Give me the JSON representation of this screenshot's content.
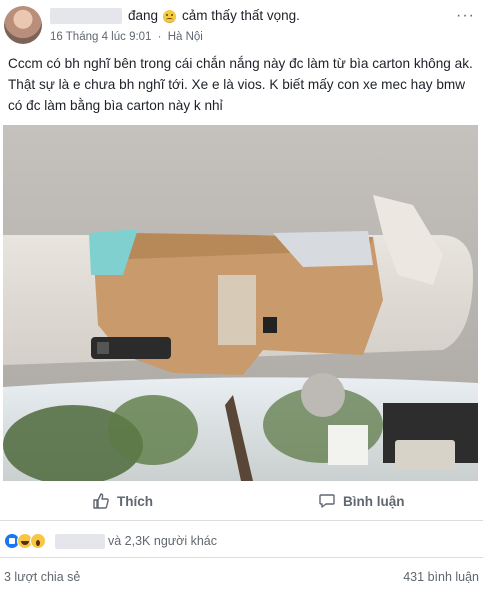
{
  "header": {
    "feeling_prefix": "đang",
    "feeling_text": "cảm thấy thất vọng.",
    "timestamp": "16 Tháng 4 lúc 9:01",
    "separator": "·",
    "location": "Hà Nội",
    "more_label": "···"
  },
  "post": {
    "text": "Cccm có bh nghĩ bên trong cái chắn nắng này đc làm từ bìa carton không ak. Thật sự là e chưa bh nghĩ tới. Xe e là vios. K biết mấy con xe mec hay bmw có đc làm bằng bìa carton này k nhỉ"
  },
  "actions": {
    "like_label": "Thích",
    "comment_label": "Bình luận"
  },
  "reactions": {
    "types": [
      "like-icon",
      "haha-icon",
      "wow-icon"
    ],
    "summary": "và 2,3K người khác"
  },
  "footer": {
    "shares": "3 lượt chia sẻ",
    "comments": "431 bình luận"
  },
  "colors": {
    "brand_blue": "#1877f2",
    "secondary_text": "#606770",
    "primary_text": "#1d2129"
  }
}
